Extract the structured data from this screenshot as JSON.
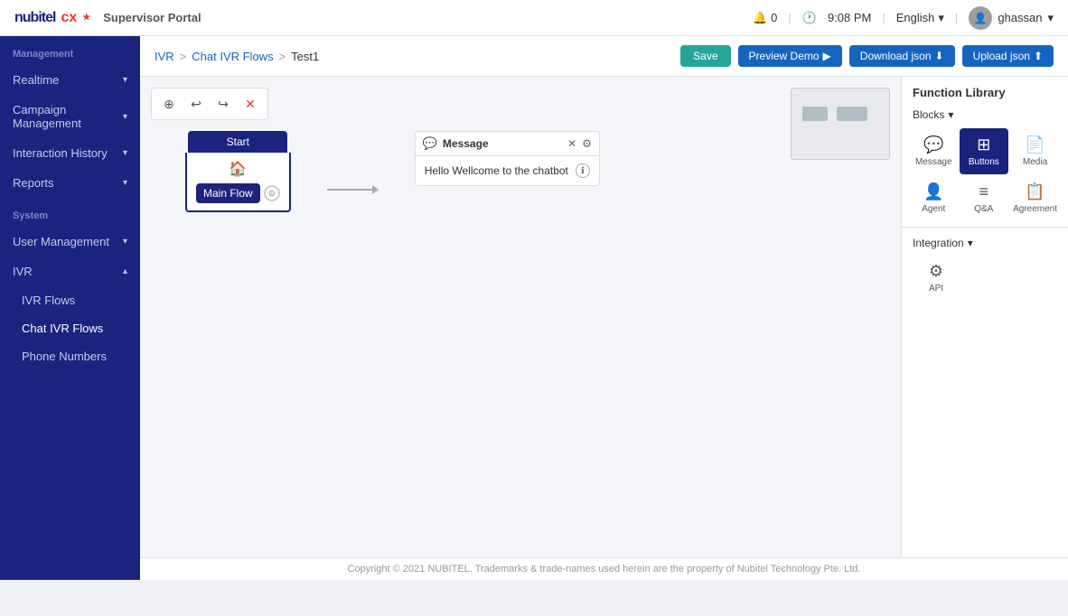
{
  "header": {
    "logo_text": "nubitel",
    "logo_cx": "cx",
    "logo_star": "★",
    "portal_title": "Supervisor Portal",
    "bell_count": "0",
    "time": "9:08 PM",
    "language": "English",
    "username": "ghassan"
  },
  "sidebar": {
    "management_label": "Management",
    "system_label": "System",
    "items": [
      {
        "id": "realtime",
        "label": "Realtime",
        "has_arrow": true
      },
      {
        "id": "campaign",
        "label": "Campaign Management",
        "has_arrow": true
      },
      {
        "id": "interaction",
        "label": "Interaction History",
        "has_arrow": true
      },
      {
        "id": "reports",
        "label": "Reports",
        "has_arrow": true
      }
    ],
    "system_items": [
      {
        "id": "user-mgmt",
        "label": "User Management",
        "has_arrow": true
      },
      {
        "id": "ivr",
        "label": "IVR",
        "has_arrow": true
      }
    ],
    "ivr_sub": [
      {
        "id": "ivr-flows",
        "label": "IVR Flows"
      },
      {
        "id": "chat-ivr-flows",
        "label": "Chat IVR Flows",
        "active": true
      },
      {
        "id": "phone-numbers",
        "label": "Phone Numbers"
      }
    ]
  },
  "breadcrumb": {
    "items": [
      "IVR",
      "Chat IVR Flows",
      "Test1"
    ],
    "separators": [
      ">",
      ">"
    ]
  },
  "toolbar_actions": {
    "save": "Save",
    "preview": "Preview Demo",
    "download": "Download json",
    "upload": "Upload json"
  },
  "canvas_tools": {
    "tool1": "⊕",
    "tool2": "↩",
    "tool3": "↪",
    "tool4": "✕"
  },
  "flow": {
    "start_label": "Start",
    "start_icon": "🏠",
    "main_flow_label": "Main Flow",
    "message_title": "Message",
    "message_text": "Hello Wellcome to the chatbot"
  },
  "function_library": {
    "title": "Function Library",
    "blocks_label": "Blocks",
    "items": [
      {
        "id": "message",
        "label": "Message",
        "icon": "💬"
      },
      {
        "id": "buttons",
        "label": "Buttons",
        "icon": "⊞",
        "active": true
      },
      {
        "id": "media",
        "label": "Media",
        "icon": "📄"
      },
      {
        "id": "agent",
        "label": "Agent",
        "icon": "👤"
      },
      {
        "id": "qa",
        "label": "Q&A",
        "icon": "≡"
      },
      {
        "id": "agreement",
        "label": "Agreement",
        "icon": "📋"
      }
    ],
    "integration_label": "Integration",
    "api_label": "API",
    "api_icon": "⚙"
  },
  "footer": {
    "text": "Copyright © 2021 NUBITEL. Trademarks & trade-names used herein are the property of Nubitel Technology Pte. Ltd."
  }
}
